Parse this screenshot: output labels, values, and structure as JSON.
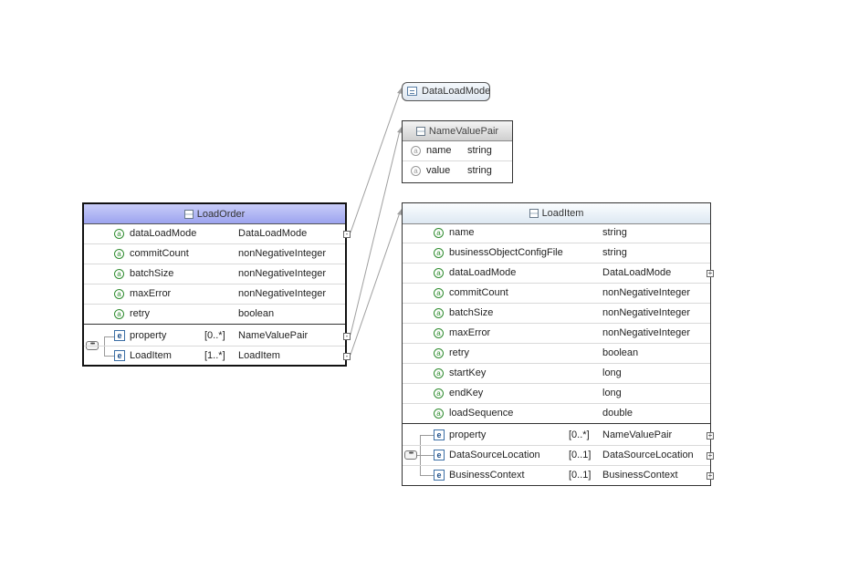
{
  "connector_color": "#a0a0a0",
  "enum_box": {
    "name": "DataLoadMode",
    "icon": "simple-type-icon"
  },
  "nvp_box": {
    "name": "NameValuePair",
    "attributes": [
      {
        "name": "name",
        "type": "string"
      },
      {
        "name": "value",
        "type": "string"
      }
    ]
  },
  "load_order": {
    "name": "LoadOrder",
    "attributes": [
      {
        "name": "dataLoadMode",
        "type": "DataLoadMode"
      },
      {
        "name": "commitCount",
        "type": "nonNegativeInteger"
      },
      {
        "name": "batchSize",
        "type": "nonNegativeInteger"
      },
      {
        "name": "maxError",
        "type": "nonNegativeInteger"
      },
      {
        "name": "retry",
        "type": "boolean"
      }
    ],
    "elements": [
      {
        "name": "property",
        "card": "[0..*]",
        "type": "NameValuePair"
      },
      {
        "name": "LoadItem",
        "card": "[1..*]",
        "type": "LoadItem"
      }
    ]
  },
  "load_item": {
    "name": "LoadItem",
    "attributes": [
      {
        "name": "name",
        "type": "string"
      },
      {
        "name": "businessObjectConfigFile",
        "type": "string"
      },
      {
        "name": "dataLoadMode",
        "type": "DataLoadMode"
      },
      {
        "name": "commitCount",
        "type": "nonNegativeInteger"
      },
      {
        "name": "batchSize",
        "type": "nonNegativeInteger"
      },
      {
        "name": "maxError",
        "type": "nonNegativeInteger"
      },
      {
        "name": "retry",
        "type": "boolean"
      },
      {
        "name": "startKey",
        "type": "long"
      },
      {
        "name": "endKey",
        "type": "long"
      },
      {
        "name": "loadSequence",
        "type": "double"
      }
    ],
    "elements": [
      {
        "name": "property",
        "card": "[0..*]",
        "type": "NameValuePair"
      },
      {
        "name": "DataSourceLocation",
        "card": "[0..1]",
        "type": "DataSourceLocation"
      },
      {
        "name": "BusinessContext",
        "card": "[0..1]",
        "type": "BusinessContext"
      }
    ]
  }
}
